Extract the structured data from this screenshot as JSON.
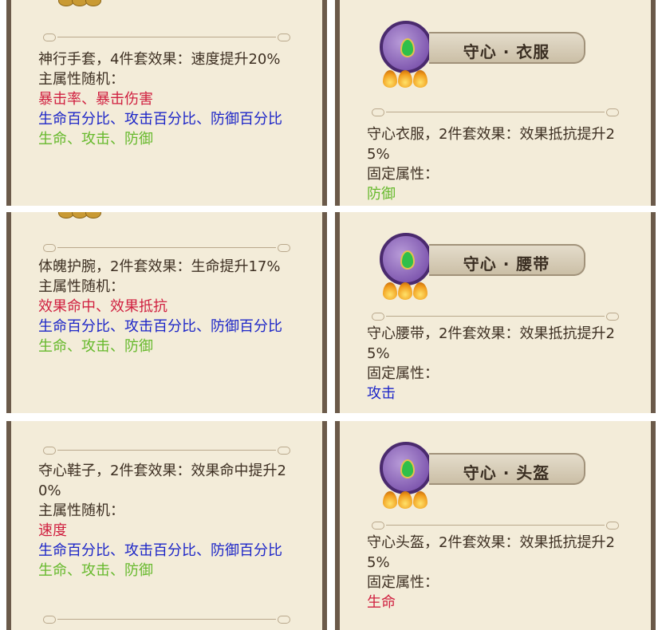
{
  "left": [
    {
      "lines": [
        {
          "text": "神行手套，4件套效果：速度提升20%",
          "color": "normal"
        },
        {
          "text": "主属性随机：",
          "color": "normal"
        },
        {
          "text": "暴击率、暴击伤害",
          "color": "red"
        },
        {
          "text": "生命百分比、攻击百分比、防御百分比",
          "color": "blue"
        },
        {
          "text": "生命、攻击、防御",
          "color": "green"
        }
      ]
    },
    {
      "lines": [
        {
          "text": "体魄护腕，2件套效果：生命提升17%",
          "color": "normal"
        },
        {
          "text": "主属性随机：",
          "color": "normal"
        },
        {
          "text": "效果命中、效果抵抗",
          "color": "red"
        },
        {
          "text": "生命百分比、攻击百分比、防御百分比",
          "color": "blue"
        },
        {
          "text": "生命、攻击、防御",
          "color": "green"
        }
      ]
    },
    {
      "lines": [
        {
          "text": "夺心鞋子，2件套效果：效果命中提升20%",
          "color": "normal"
        },
        {
          "text": "主属性随机：",
          "color": "normal"
        },
        {
          "text": "速度",
          "color": "red"
        },
        {
          "text": "生命百分比、攻击百分比、防御百分比",
          "color": "blue"
        },
        {
          "text": "生命、攻击、防御",
          "color": "green"
        }
      ]
    }
  ],
  "right": [
    {
      "title": "守心 · 衣服",
      "icon": "armor-icon",
      "lines": [
        {
          "text": "守心衣服，2件套效果：效果抵抗提升25%",
          "color": "normal"
        },
        {
          "text": "固定属性：",
          "color": "normal"
        },
        {
          "text": "防御",
          "color": "green"
        }
      ]
    },
    {
      "title": "守心 · 腰带",
      "icon": "belt-icon",
      "lines": [
        {
          "text": "守心腰带，2件套效果：效果抵抗提升25%",
          "color": "normal"
        },
        {
          "text": "固定属性：",
          "color": "normal"
        },
        {
          "text": "攻击",
          "color": "blue"
        }
      ]
    },
    {
      "title": "守心 · 头盔",
      "icon": "helmet-icon",
      "lines": [
        {
          "text": "守心头盔，2件套效果：效果抵抗提升25%",
          "color": "normal"
        },
        {
          "text": "固定属性：",
          "color": "normal"
        },
        {
          "text": "生命",
          "color": "red"
        }
      ]
    }
  ],
  "colors": {
    "red": "#d02040",
    "blue": "#1d26c8",
    "green": "#66b92c",
    "text": "#3d2f22",
    "panel": "#f3ecd9"
  }
}
